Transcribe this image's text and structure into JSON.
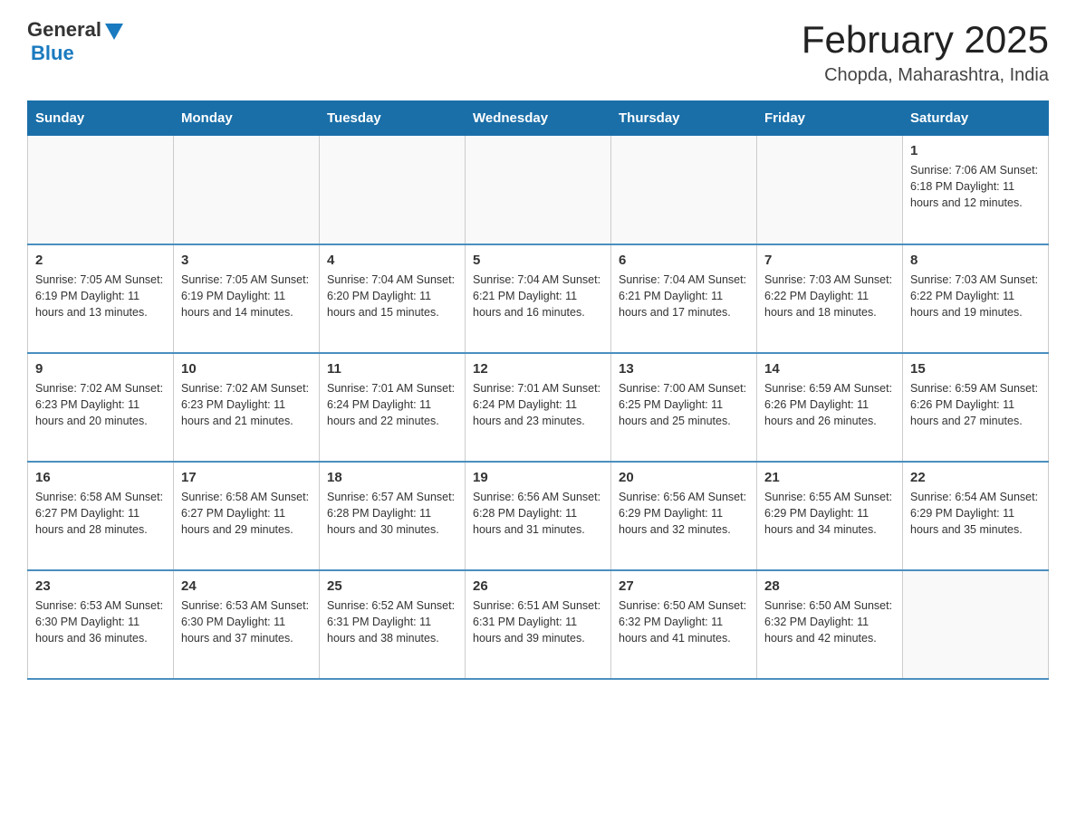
{
  "header": {
    "logo_general": "General",
    "logo_blue": "Blue",
    "title": "February 2025",
    "subtitle": "Chopda, Maharashtra, India"
  },
  "days_of_week": [
    "Sunday",
    "Monday",
    "Tuesday",
    "Wednesday",
    "Thursday",
    "Friday",
    "Saturday"
  ],
  "weeks": [
    [
      {
        "day": "",
        "info": ""
      },
      {
        "day": "",
        "info": ""
      },
      {
        "day": "",
        "info": ""
      },
      {
        "day": "",
        "info": ""
      },
      {
        "day": "",
        "info": ""
      },
      {
        "day": "",
        "info": ""
      },
      {
        "day": "1",
        "info": "Sunrise: 7:06 AM\nSunset: 6:18 PM\nDaylight: 11 hours and 12 minutes."
      }
    ],
    [
      {
        "day": "2",
        "info": "Sunrise: 7:05 AM\nSunset: 6:19 PM\nDaylight: 11 hours and 13 minutes."
      },
      {
        "day": "3",
        "info": "Sunrise: 7:05 AM\nSunset: 6:19 PM\nDaylight: 11 hours and 14 minutes."
      },
      {
        "day": "4",
        "info": "Sunrise: 7:04 AM\nSunset: 6:20 PM\nDaylight: 11 hours and 15 minutes."
      },
      {
        "day": "5",
        "info": "Sunrise: 7:04 AM\nSunset: 6:21 PM\nDaylight: 11 hours and 16 minutes."
      },
      {
        "day": "6",
        "info": "Sunrise: 7:04 AM\nSunset: 6:21 PM\nDaylight: 11 hours and 17 minutes."
      },
      {
        "day": "7",
        "info": "Sunrise: 7:03 AM\nSunset: 6:22 PM\nDaylight: 11 hours and 18 minutes."
      },
      {
        "day": "8",
        "info": "Sunrise: 7:03 AM\nSunset: 6:22 PM\nDaylight: 11 hours and 19 minutes."
      }
    ],
    [
      {
        "day": "9",
        "info": "Sunrise: 7:02 AM\nSunset: 6:23 PM\nDaylight: 11 hours and 20 minutes."
      },
      {
        "day": "10",
        "info": "Sunrise: 7:02 AM\nSunset: 6:23 PM\nDaylight: 11 hours and 21 minutes."
      },
      {
        "day": "11",
        "info": "Sunrise: 7:01 AM\nSunset: 6:24 PM\nDaylight: 11 hours and 22 minutes."
      },
      {
        "day": "12",
        "info": "Sunrise: 7:01 AM\nSunset: 6:24 PM\nDaylight: 11 hours and 23 minutes."
      },
      {
        "day": "13",
        "info": "Sunrise: 7:00 AM\nSunset: 6:25 PM\nDaylight: 11 hours and 25 minutes."
      },
      {
        "day": "14",
        "info": "Sunrise: 6:59 AM\nSunset: 6:26 PM\nDaylight: 11 hours and 26 minutes."
      },
      {
        "day": "15",
        "info": "Sunrise: 6:59 AM\nSunset: 6:26 PM\nDaylight: 11 hours and 27 minutes."
      }
    ],
    [
      {
        "day": "16",
        "info": "Sunrise: 6:58 AM\nSunset: 6:27 PM\nDaylight: 11 hours and 28 minutes."
      },
      {
        "day": "17",
        "info": "Sunrise: 6:58 AM\nSunset: 6:27 PM\nDaylight: 11 hours and 29 minutes."
      },
      {
        "day": "18",
        "info": "Sunrise: 6:57 AM\nSunset: 6:28 PM\nDaylight: 11 hours and 30 minutes."
      },
      {
        "day": "19",
        "info": "Sunrise: 6:56 AM\nSunset: 6:28 PM\nDaylight: 11 hours and 31 minutes."
      },
      {
        "day": "20",
        "info": "Sunrise: 6:56 AM\nSunset: 6:29 PM\nDaylight: 11 hours and 32 minutes."
      },
      {
        "day": "21",
        "info": "Sunrise: 6:55 AM\nSunset: 6:29 PM\nDaylight: 11 hours and 34 minutes."
      },
      {
        "day": "22",
        "info": "Sunrise: 6:54 AM\nSunset: 6:29 PM\nDaylight: 11 hours and 35 minutes."
      }
    ],
    [
      {
        "day": "23",
        "info": "Sunrise: 6:53 AM\nSunset: 6:30 PM\nDaylight: 11 hours and 36 minutes."
      },
      {
        "day": "24",
        "info": "Sunrise: 6:53 AM\nSunset: 6:30 PM\nDaylight: 11 hours and 37 minutes."
      },
      {
        "day": "25",
        "info": "Sunrise: 6:52 AM\nSunset: 6:31 PM\nDaylight: 11 hours and 38 minutes."
      },
      {
        "day": "26",
        "info": "Sunrise: 6:51 AM\nSunset: 6:31 PM\nDaylight: 11 hours and 39 minutes."
      },
      {
        "day": "27",
        "info": "Sunrise: 6:50 AM\nSunset: 6:32 PM\nDaylight: 11 hours and 41 minutes."
      },
      {
        "day": "28",
        "info": "Sunrise: 6:50 AM\nSunset: 6:32 PM\nDaylight: 11 hours and 42 minutes."
      },
      {
        "day": "",
        "info": ""
      }
    ]
  ]
}
